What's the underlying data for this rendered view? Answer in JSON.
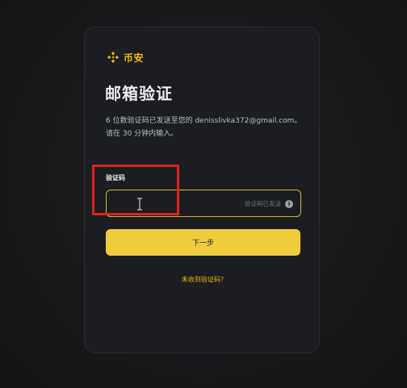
{
  "brand": {
    "name": "币安",
    "color": "#f0b90b"
  },
  "page": {
    "title": "邮箱验证",
    "description": "6 位数验证码已发送至您的 denisslivka372@gmail.com。请在 30 分钟内输入。"
  },
  "form": {
    "code_label": "验证码",
    "code_value": "",
    "sent_hint": "验证码已发送",
    "info_icon": "info-icon",
    "next_label": "下一步",
    "resend_link": "未收到验证码?"
  },
  "colors": {
    "accent": "#f0cc3c",
    "highlight": "#e02020"
  }
}
